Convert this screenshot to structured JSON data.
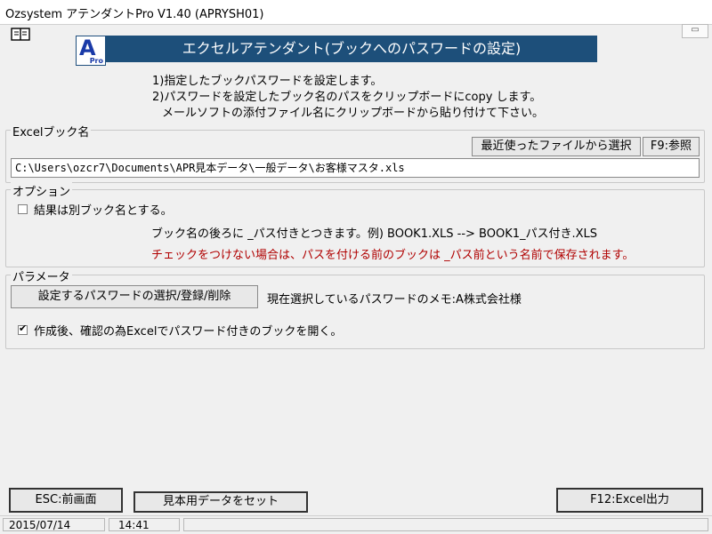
{
  "window": {
    "title": "Ozsystem アテンダントPro V1.40 (APRYSH01)"
  },
  "header": {
    "logo_letter": "A",
    "logo_sub": "Pro",
    "banner": "エクセルアテンダント(ブックへのパスワードの設定)"
  },
  "description": [
    "1)指定したブックパスワードを設定します。",
    "2)パスワードを設定したブック名のパスをクリップボードにcopy します。",
    "メールソフトの添付ファイル名にクリップボードから貼り付けて下さい。"
  ],
  "excel_book": {
    "label": "Excelブック名",
    "recent_button": "最近使ったファイルから選択",
    "browse_button": "F9:参照",
    "path": "C:\\Users\\ozcr7\\Documents\\APR見本データ\\一般データ\\お客様マスタ.xls"
  },
  "options": {
    "label": "オプション",
    "separate_book_label": "結果は別ブック名とする。",
    "separate_book_checked": false,
    "note1": "ブック名の後ろに _パス付きとつきます。例) BOOK1.XLS --> BOOK1_パス付き.XLS",
    "note2": "チェックをつけない場合は、パスを付ける前のブックは _パス前という名前で保存されます。"
  },
  "parameters": {
    "label": "パラメータ",
    "select_password_button": "設定するパスワードの選択/登録/削除",
    "current_password_memo": "現在選択しているパスワードのメモ:A株式会社様",
    "open_after_label": "作成後、確認の為Excelでパスワード付きのブックを開く。",
    "open_after_checked": true
  },
  "footer": {
    "esc_button": "ESC:前画面",
    "sample_button": "見本用データをセット",
    "f12_button": "F12:Excel出力"
  },
  "status": {
    "date": "2015/07/14",
    "time": "14:41"
  },
  "colors": {
    "banner_bg": "#1d4f7a",
    "note_red": "#b00000",
    "logo_blue": "#1a3aa8"
  }
}
